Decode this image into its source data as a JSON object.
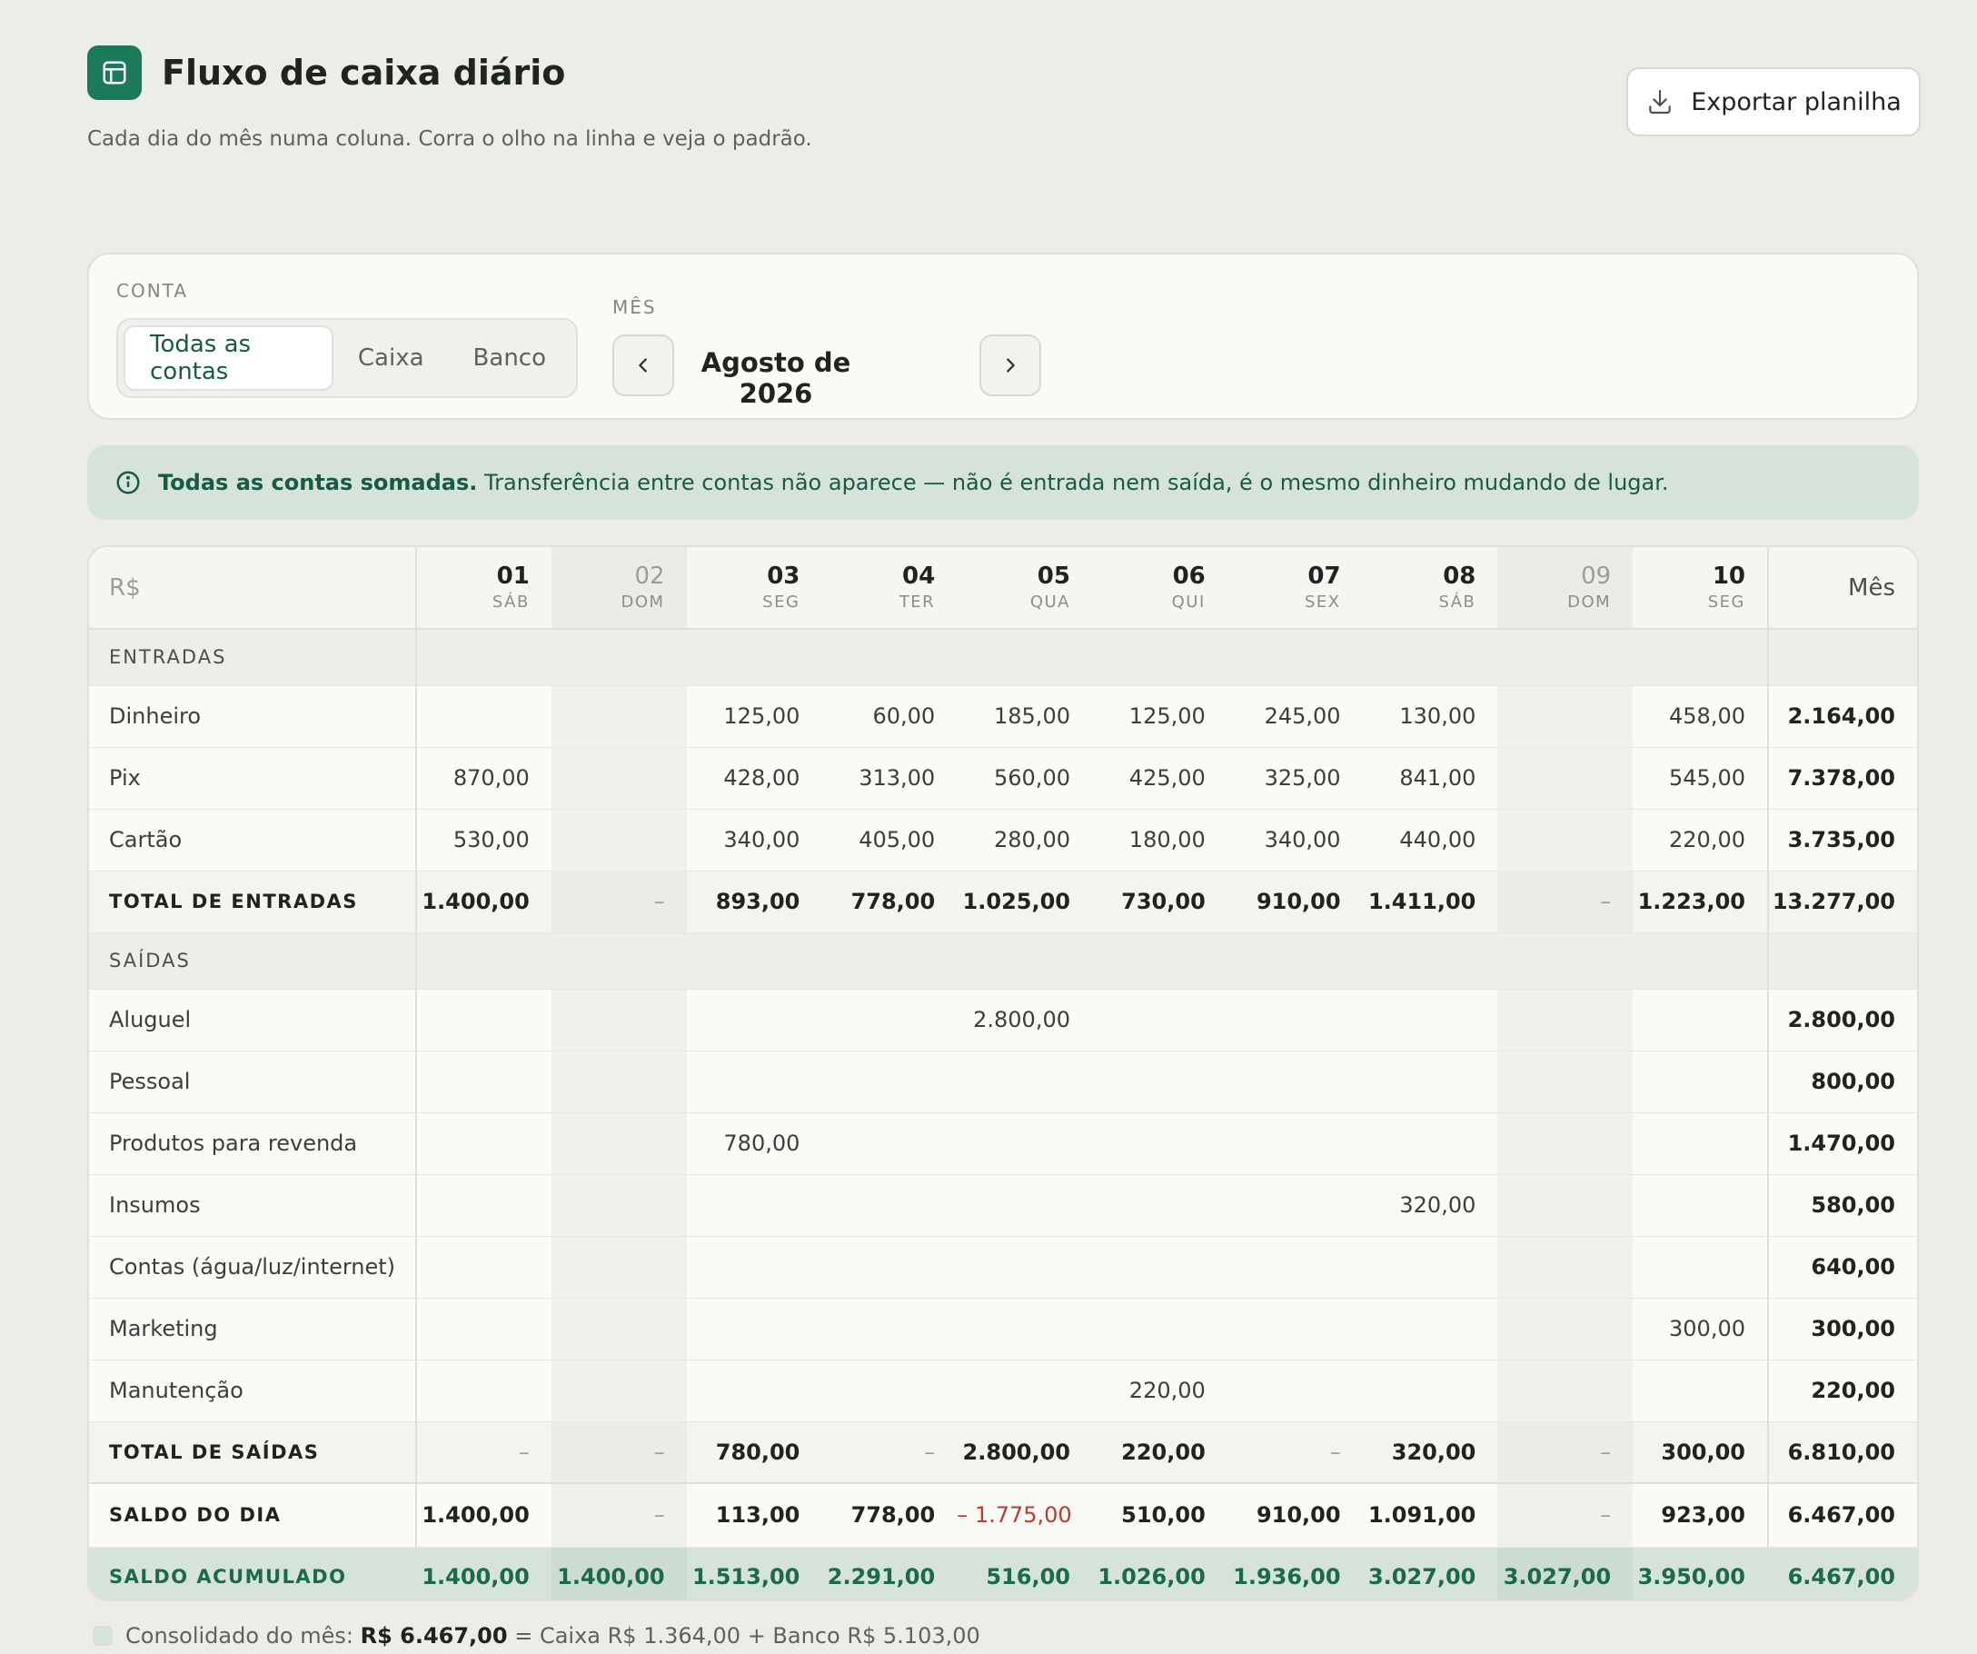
{
  "header": {
    "title": "Fluxo de caixa diário",
    "subtitle": "Cada dia do mês numa coluna. Corra o olho na linha e veja o padrão.",
    "export_label": "Exportar planilha"
  },
  "filters": {
    "account_label": "CONTA",
    "accounts": [
      "Todas as contas",
      "Caixa",
      "Banco"
    ],
    "selected_account": "Todas as contas",
    "month_label": "MÊS",
    "month_value": "Agosto de 2026"
  },
  "info": {
    "bold": "Todas as contas somadas.",
    "text": " Transferência entre contas não aparece — não é entrada nem saída, é o mesmo dinheiro mudando de lugar."
  },
  "table": {
    "currency": "R$",
    "month_header": "Mês",
    "days": [
      {
        "num": "01",
        "dow": "SÁB",
        "weekend": false
      },
      {
        "num": "02",
        "dow": "DOM",
        "weekend": true
      },
      {
        "num": "03",
        "dow": "SEG",
        "weekend": false
      },
      {
        "num": "04",
        "dow": "TER",
        "weekend": false
      },
      {
        "num": "05",
        "dow": "QUA",
        "weekend": false
      },
      {
        "num": "06",
        "dow": "QUI",
        "weekend": false
      },
      {
        "num": "07",
        "dow": "SEX",
        "weekend": false
      },
      {
        "num": "08",
        "dow": "SÁB",
        "weekend": false
      },
      {
        "num": "09",
        "dow": "DOM",
        "weekend": true
      },
      {
        "num": "10",
        "dow": "SEG",
        "weekend": false
      }
    ],
    "sections": [
      {
        "title": "ENTRADAS",
        "rows": [
          {
            "label": "Dinheiro",
            "values": [
              "",
              "",
              "125,00",
              "60,00",
              "185,00",
              "125,00",
              "245,00",
              "130,00",
              "",
              "458,00"
            ],
            "month": "2.164,00"
          },
          {
            "label": "Pix",
            "values": [
              "870,00",
              "",
              "428,00",
              "313,00",
              "560,00",
              "425,00",
              "325,00",
              "841,00",
              "",
              "545,00"
            ],
            "month": "7.378,00"
          },
          {
            "label": "Cartão",
            "values": [
              "530,00",
              "",
              "340,00",
              "405,00",
              "280,00",
              "180,00",
              "340,00",
              "440,00",
              "",
              "220,00"
            ],
            "month": "3.735,00"
          }
        ],
        "total": {
          "label": "TOTAL DE ENTRADAS",
          "values": [
            "1.400,00",
            "–",
            "893,00",
            "778,00",
            "1.025,00",
            "730,00",
            "910,00",
            "1.411,00",
            "–",
            "1.223,00"
          ],
          "month": "13.277,00"
        }
      },
      {
        "title": "SAÍDAS",
        "rows": [
          {
            "label": "Aluguel",
            "values": [
              "",
              "",
              "",
              "",
              "2.800,00",
              "",
              "",
              "",
              "",
              ""
            ],
            "month": "2.800,00"
          },
          {
            "label": "Pessoal",
            "values": [
              "",
              "",
              "",
              "",
              "",
              "",
              "",
              "",
              "",
              ""
            ],
            "month": "800,00"
          },
          {
            "label": "Produtos para revenda",
            "values": [
              "",
              "",
              "780,00",
              "",
              "",
              "",
              "",
              "",
              "",
              ""
            ],
            "month": "1.470,00"
          },
          {
            "label": "Insumos",
            "values": [
              "",
              "",
              "",
              "",
              "",
              "",
              "",
              "320,00",
              "",
              ""
            ],
            "month": "580,00"
          },
          {
            "label": "Contas (água/luz/internet)",
            "values": [
              "",
              "",
              "",
              "",
              "",
              "",
              "",
              "",
              "",
              ""
            ],
            "month": "640,00"
          },
          {
            "label": "Marketing",
            "values": [
              "",
              "",
              "",
              "",
              "",
              "",
              "",
              "",
              "",
              "300,00"
            ],
            "month": "300,00"
          },
          {
            "label": "Manutenção",
            "values": [
              "",
              "",
              "",
              "",
              "",
              "220,00",
              "",
              "",
              "",
              ""
            ],
            "month": "220,00"
          }
        ],
        "total": {
          "label": "TOTAL DE SAÍDAS",
          "values": [
            "–",
            "–",
            "780,00",
            "–",
            "2.800,00",
            "220,00",
            "–",
            "320,00",
            "–",
            "300,00"
          ],
          "month": "6.810,00"
        }
      }
    ],
    "saldo_dia": {
      "label": "SALDO DO DIA",
      "values": [
        "1.400,00",
        "–",
        "113,00",
        "778,00",
        "– 1.775,00",
        "510,00",
        "910,00",
        "1.091,00",
        "–",
        "923,00"
      ],
      "month": "6.467,00"
    },
    "saldo_acumulado": {
      "label": "SALDO ACUMULADO",
      "values": [
        "1.400,00",
        "1.400,00",
        "1.513,00",
        "2.291,00",
        "516,00",
        "1.026,00",
        "1.936,00",
        "3.027,00",
        "3.027,00",
        "3.950,00"
      ],
      "month": "6.467,00"
    }
  },
  "footer": {
    "prefix": "Consolidado do mês:",
    "total": "R$ 6.467,00",
    "rest": "= Caixa R$ 1.364,00 + Banco R$ 5.103,00"
  },
  "colors": {
    "accent": "#1a7a5a",
    "negative": "#c0392b",
    "highlight": "#d5e3db"
  }
}
